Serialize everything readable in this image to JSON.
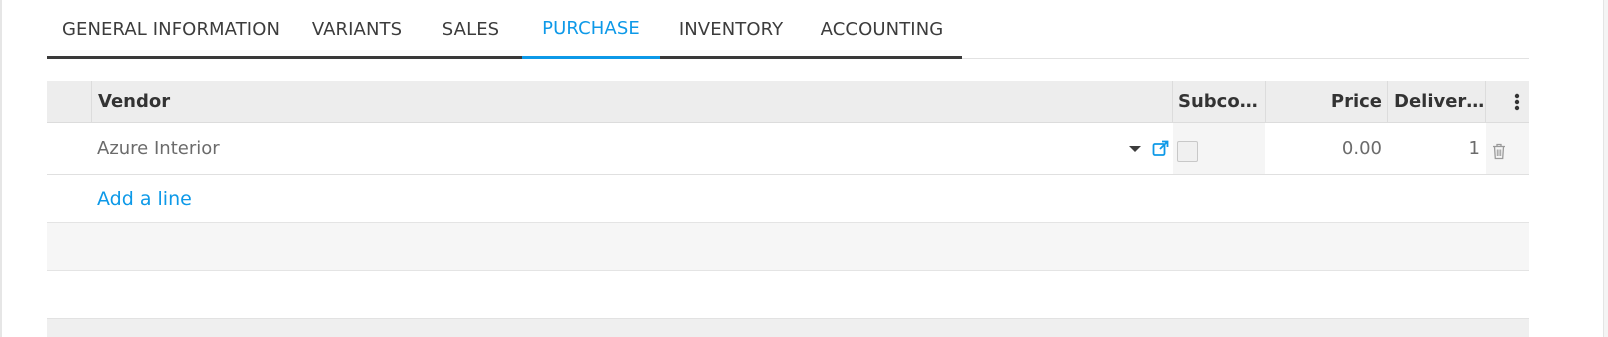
{
  "tabs": [
    {
      "label": "GENERAL INFORMATION",
      "active": false
    },
    {
      "label": "VARIANTS",
      "active": false
    },
    {
      "label": "SALES",
      "active": false
    },
    {
      "label": "PURCHASE",
      "active": true
    },
    {
      "label": "INVENTORY",
      "active": false
    },
    {
      "label": "ACCOUNTING",
      "active": false
    }
  ],
  "table": {
    "headers": {
      "vendor": "Vendor",
      "subcontractor": "Subco…",
      "price": "Price",
      "delivery": "Deliver…"
    },
    "rows": [
      {
        "vendor": "Azure Interior",
        "subcontractor": false,
        "price": "0.00",
        "delivery": "1"
      }
    ],
    "add_line_label": "Add a line"
  },
  "icons": {
    "dropdown": "caret-down-icon",
    "external": "external-link-icon",
    "delete": "trash-icon",
    "options": "vertical-dots-icon"
  },
  "colors": {
    "accent": "#0d99e8",
    "header_bg": "#ededed",
    "text": "#4a4a4a"
  }
}
